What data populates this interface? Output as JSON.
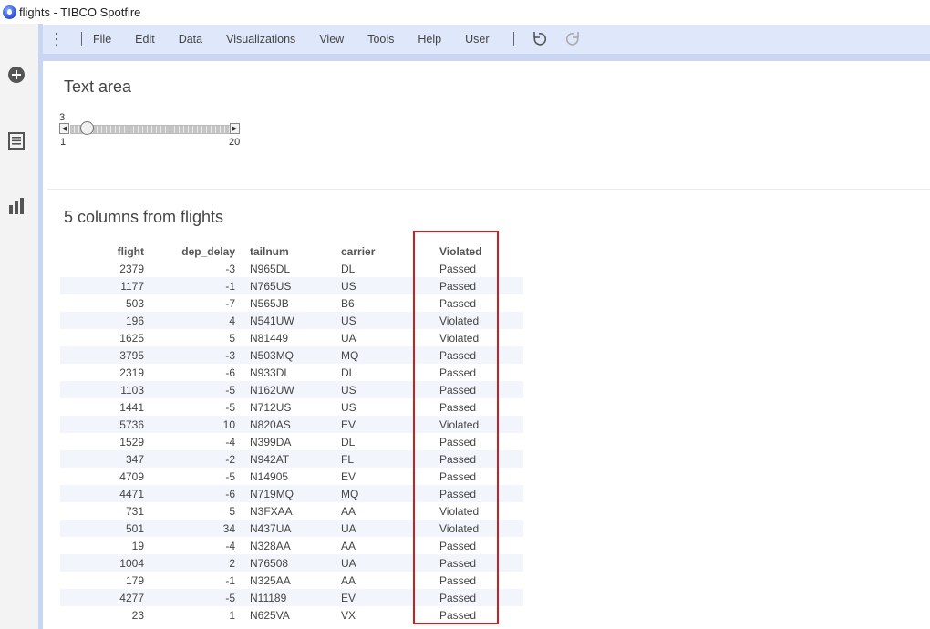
{
  "window": {
    "title": "flights - TIBCO Spotfire"
  },
  "menu": {
    "items": [
      "File",
      "Edit",
      "Data",
      "Visualizations",
      "View",
      "Tools",
      "Help",
      "User"
    ]
  },
  "text_area": {
    "title": "Text area",
    "slider": {
      "value": "3",
      "min": "1",
      "max": "20",
      "level_fraction": 0.105
    }
  },
  "table": {
    "title": "5 columns from flights",
    "columns": [
      "flight",
      "dep_delay",
      "tailnum",
      "carrier",
      "Violated"
    ],
    "rows": [
      [
        "2379",
        "-3",
        "N965DL",
        "DL",
        "Passed"
      ],
      [
        "1177",
        "-1",
        "N765US",
        "US",
        "Passed"
      ],
      [
        "503",
        "-7",
        "N565JB",
        "B6",
        "Passed"
      ],
      [
        "196",
        "4",
        "N541UW",
        "US",
        "Violated"
      ],
      [
        "1625",
        "5",
        "N81449",
        "UA",
        "Violated"
      ],
      [
        "3795",
        "-3",
        "N503MQ",
        "MQ",
        "Passed"
      ],
      [
        "2319",
        "-6",
        "N933DL",
        "DL",
        "Passed"
      ],
      [
        "1103",
        "-5",
        "N162UW",
        "US",
        "Passed"
      ],
      [
        "1441",
        "-5",
        "N712US",
        "US",
        "Passed"
      ],
      [
        "5736",
        "10",
        "N820AS",
        "EV",
        "Violated"
      ],
      [
        "1529",
        "-4",
        "N399DA",
        "DL",
        "Passed"
      ],
      [
        "347",
        "-2",
        "N942AT",
        "FL",
        "Passed"
      ],
      [
        "4709",
        "-5",
        "N14905",
        "EV",
        "Passed"
      ],
      [
        "4471",
        "-6",
        "N719MQ",
        "MQ",
        "Passed"
      ],
      [
        "731",
        "5",
        "N3FXAA",
        "AA",
        "Violated"
      ],
      [
        "501",
        "34",
        "N437UA",
        "UA",
        "Violated"
      ],
      [
        "19",
        "-4",
        "N328AA",
        "AA",
        "Passed"
      ],
      [
        "1004",
        "2",
        "N76508",
        "UA",
        "Passed"
      ],
      [
        "179",
        "-1",
        "N325AA",
        "AA",
        "Passed"
      ],
      [
        "4277",
        "-5",
        "N11189",
        "EV",
        "Passed"
      ],
      [
        "23",
        "1",
        "N625VA",
        "VX",
        "Passed"
      ]
    ]
  },
  "colors": {
    "accent": "#dfe7fb",
    "highlight": "#cc1f1f",
    "row_alt": "#f2f5fb"
  },
  "icons": {
    "app": "spotfire-logo-icon",
    "nav": [
      "add-circle-icon",
      "document-list-icon",
      "bar-chart-icon"
    ],
    "menu_more": "vertical-dots-icon",
    "undo": "undo-icon",
    "redo": "redo-icon"
  }
}
